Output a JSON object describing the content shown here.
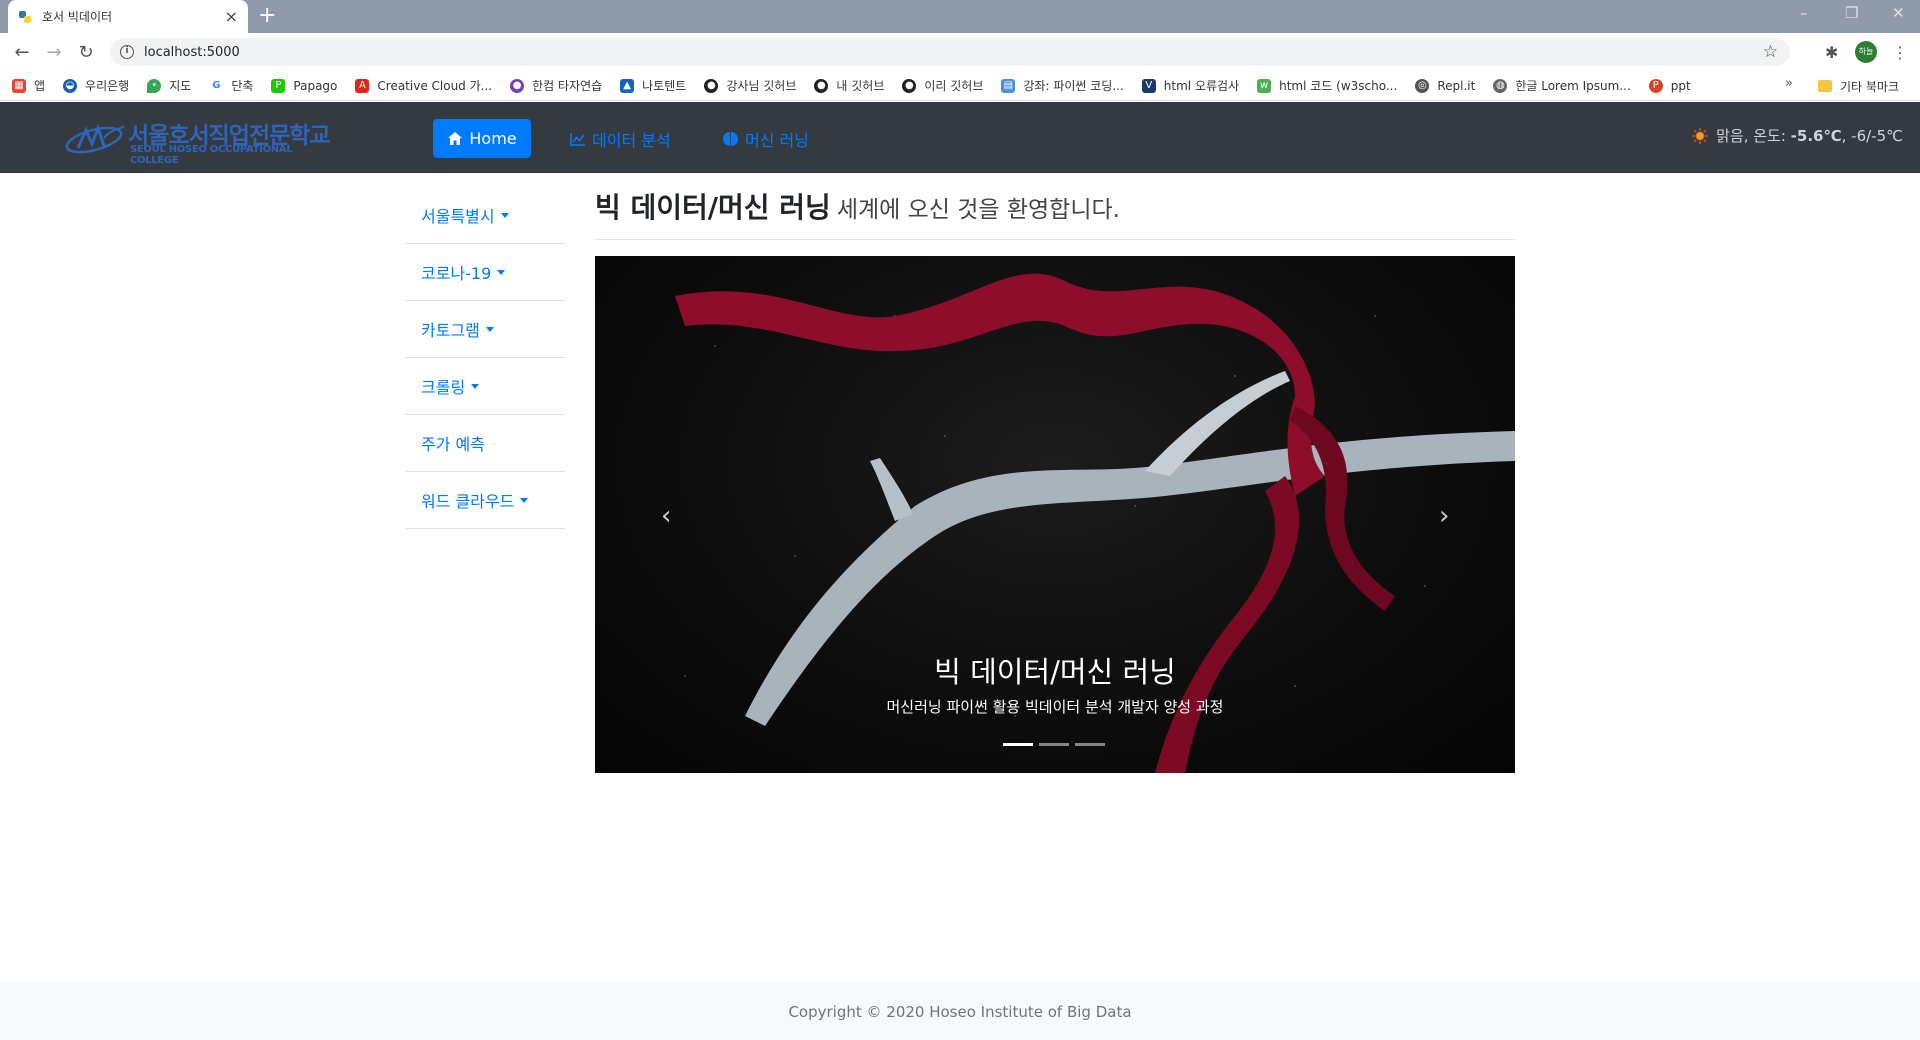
{
  "browser": {
    "tab_title": "호서 빅데이터",
    "url": "localhost:5000",
    "profile_label": "하늘",
    "bookmarks": [
      "앱",
      "우리은행",
      "지도",
      "단축",
      "Papago",
      "Creative Cloud 가...",
      "한컴 타자연습",
      "나토텐트",
      "강사님 깃허브",
      "내 깃허브",
      "이리 깃허브",
      "강좌: 파이썬 코딩...",
      "html 오류검사",
      "html 코드 (w3scho...",
      "Repl.it",
      "한글 Lorem Ipsum...",
      "ppt"
    ],
    "other_bookmarks": "기타 북마크",
    "more": "»"
  },
  "navbar": {
    "logo_ko": "서울호서직업전문학교",
    "logo_en": "SEOUL HOSEO OCCUPATIONAL COLLEGE",
    "home": "Home",
    "data_analysis": "데이터 분석",
    "machine_learning": "머신 러닝",
    "weather_prefix": "맑음, 온도: ",
    "weather_temp": "-5.6℃",
    "weather_range": ", -6/-5℃"
  },
  "sidebar": {
    "items": [
      {
        "label": "서울특별시",
        "dropdown": true
      },
      {
        "label": "코로나-19",
        "dropdown": true
      },
      {
        "label": "카토그램",
        "dropdown": true
      },
      {
        "label": "크롤링",
        "dropdown": true
      },
      {
        "label": "주가 예측",
        "dropdown": false
      },
      {
        "label": "워드 클라우드",
        "dropdown": true
      }
    ]
  },
  "main": {
    "heading_strong": "빅 데이터/머신 러닝",
    "heading_rest": "세계에 오신 것을 환영합니다."
  },
  "carousel": {
    "caption_title": "빅 데이터/머신 러닝",
    "caption_text": "머신러닝 파이썬 활용 빅데이터 분석 개발자 양성 과정",
    "slide_count": 3,
    "active_slide": 1
  },
  "footer": {
    "copyright": "Copyright © 2020 Hoseo Institute of Big Data"
  },
  "colors": {
    "navbar_bg": "#343a40",
    "primary": "#007bff",
    "footer_bg": "#f8f9fa"
  }
}
